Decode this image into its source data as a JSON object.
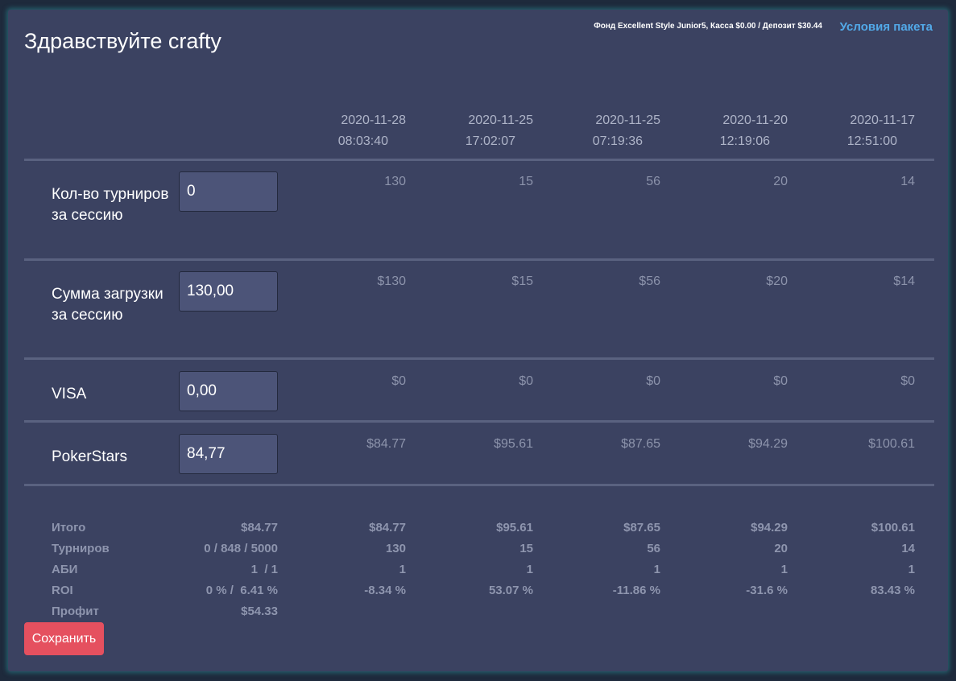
{
  "header": {
    "greeting": "Здравствуйте crafty",
    "fund_info": "Фонд Excellent Style Junior5, Касса $0.00 / Депозит $30.44",
    "package_link": "Условия пакета"
  },
  "sessions": [
    {
      "date": "2020-11-28",
      "time": "08:03:40"
    },
    {
      "date": "2020-11-25",
      "time": "17:02:07"
    },
    {
      "date": "2020-11-25",
      "time": "07:19:36"
    },
    {
      "date": "2020-11-20",
      "time": "12:19:06"
    },
    {
      "date": "2020-11-17",
      "time": "12:51:00"
    }
  ],
  "rows": [
    {
      "label": "Кол-во турниров за сессию",
      "input_value": "0",
      "values": [
        "130",
        "15",
        "56",
        "20",
        "14"
      ]
    },
    {
      "label": "Сумма загрузки за сессию",
      "input_value": "130,00",
      "values": [
        "$130",
        "$15",
        "$56",
        "$20",
        "$14"
      ]
    },
    {
      "label": "VISA",
      "input_value": "0,00",
      "values": [
        "$0",
        "$0",
        "$0",
        "$0",
        "$0"
      ]
    },
    {
      "label": "PokerStars",
      "input_value": "84,77",
      "values": [
        "$84.77",
        "$95.61",
        "$87.65",
        "$94.29",
        "$100.61"
      ]
    }
  ],
  "summary": [
    {
      "label": "Итого",
      "current": "$84.77",
      "values": [
        "$84.77",
        "$95.61",
        "$87.65",
        "$94.29",
        "$100.61"
      ]
    },
    {
      "label": "Турниров",
      "current": "0 / 848 / 5000",
      "values": [
        "130",
        "15",
        "56",
        "20",
        "14"
      ]
    },
    {
      "label": "АБИ",
      "current": "1  / 1",
      "values": [
        "1",
        "1",
        "1",
        "1",
        "1"
      ]
    },
    {
      "label": "ROI",
      "current": "0 % /  6.41 %",
      "values": [
        "-8.34 %",
        "53.07 %",
        "-11.86 %",
        "-31.6 %",
        "83.43 %"
      ]
    },
    {
      "label": "Профит",
      "current": "$54.33",
      "values": []
    }
  ],
  "actions": {
    "save_label": "Сохранить"
  }
}
